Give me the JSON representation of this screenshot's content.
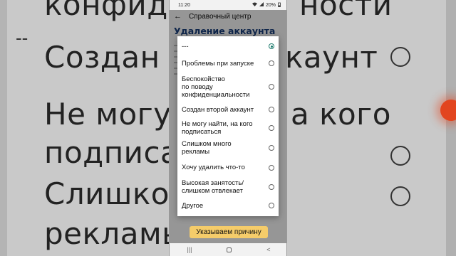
{
  "background": {
    "rows": [
      "конфиде",
      "ности",
      "Создан в",
      "каунт",
      "Не могу н",
      "а кого",
      "подписат",
      "Слишком",
      "рекламы"
    ],
    "dash": "--"
  },
  "status_bar": {
    "time": "11:20",
    "battery": "20%"
  },
  "app_bar": {
    "back_icon": "←",
    "title": "Справочный центр"
  },
  "page": {
    "heading": "Удаление аккаунта",
    "cta_label": "Указываем причину"
  },
  "dialog": {
    "options": [
      {
        "label": "---",
        "selected": true
      },
      {
        "label": "Проблемы при запуске",
        "selected": false
      },
      {
        "label": "Беспокойство\nпо поводу\nконфиденциальности",
        "selected": false
      },
      {
        "label": "Создан второй аккаунт",
        "selected": false
      },
      {
        "label": "Не могу найти, на кого\nподписаться",
        "selected": false
      },
      {
        "label": "Слишком много\nрекламы",
        "selected": false
      },
      {
        "label": "Хочу удалить что-то",
        "selected": false
      },
      {
        "label": "Высокая занятость/\nслишком отвлекает",
        "selected": false
      },
      {
        "label": "Другое",
        "selected": false
      }
    ]
  },
  "nav_bar": {
    "recent_icon": "|||",
    "back_icon": "<"
  },
  "colors": {
    "accent": "#1c7a6c",
    "heading": "#183c78",
    "button": "#f5cc6a"
  }
}
